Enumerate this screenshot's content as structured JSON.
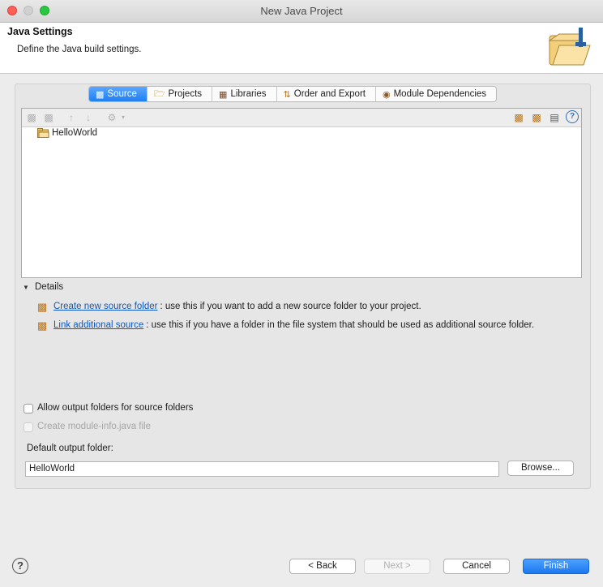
{
  "window": {
    "title": "New Java Project"
  },
  "header": {
    "title": "Java Settings",
    "subtitle": "Define the Java build settings.",
    "icon": "folder-wizard-icon"
  },
  "tabs": [
    {
      "label": "Source",
      "icon": "source-icon",
      "active": true
    },
    {
      "label": "Projects",
      "icon": "projects-icon",
      "active": false
    },
    {
      "label": "Libraries",
      "icon": "libraries-icon",
      "active": false
    },
    {
      "label": "Order and Export",
      "icon": "order-export-icon",
      "active": false
    },
    {
      "label": "Module Dependencies",
      "icon": "module-icon",
      "active": false
    }
  ],
  "tree": {
    "items": [
      {
        "label": "HelloWorld",
        "icon": "project-folder-icon"
      }
    ]
  },
  "details": {
    "label": "Details",
    "create": {
      "link": "Create new source folder",
      "text": ": use this if you want to add a new source folder to your project."
    },
    "link_src": {
      "link": "Link additional source",
      "text": ": use this if you have a folder in the file system that should be used as additional source folder."
    }
  },
  "options": {
    "allow_output": {
      "label": "Allow output folders for source folders",
      "checked": false,
      "enabled": true
    },
    "module_info": {
      "label": "Create module-info.java file",
      "checked": false,
      "enabled": false
    }
  },
  "output": {
    "label": "Default output folder:",
    "value": "HelloWorld",
    "browse": "Browse..."
  },
  "footer": {
    "back": "< Back",
    "next": "Next >",
    "cancel": "Cancel",
    "finish": "Finish"
  },
  "colors": {
    "accent": "#1f7ff2",
    "link": "#0b58c4"
  }
}
